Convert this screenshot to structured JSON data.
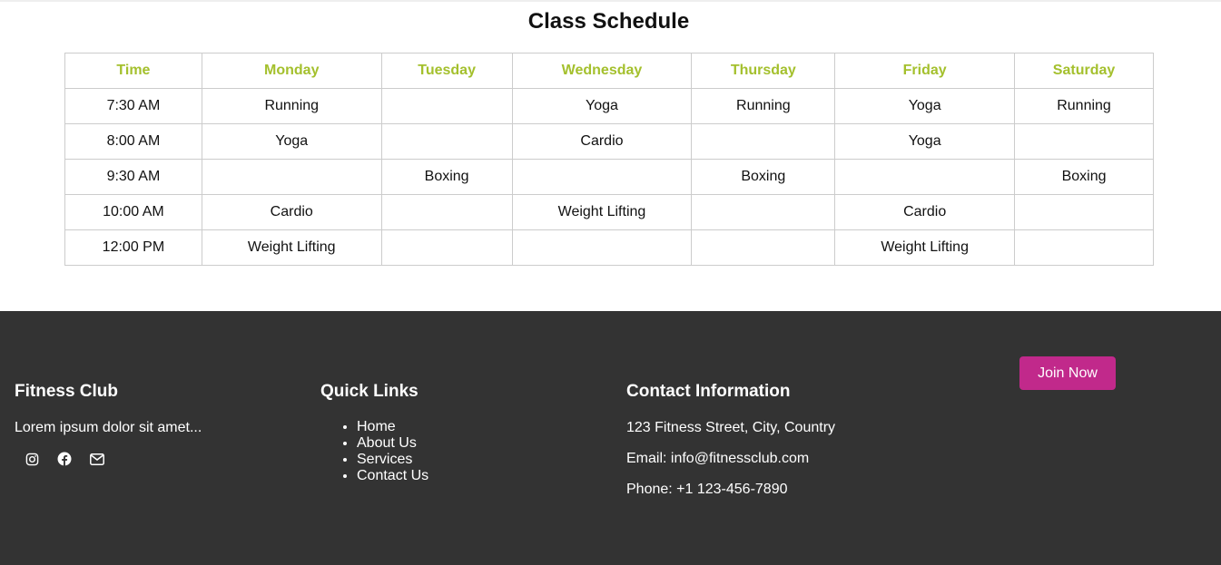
{
  "schedule": {
    "title": "Class Schedule",
    "headers": [
      "Time",
      "Monday",
      "Tuesday",
      "Wednesday",
      "Thursday",
      "Friday",
      "Saturday"
    ],
    "rows": [
      [
        "7:30 AM",
        "Running",
        "",
        "Yoga",
        "Running",
        "Yoga",
        "Running"
      ],
      [
        "8:00 AM",
        "Yoga",
        "",
        "Cardio",
        "",
        "Yoga",
        ""
      ],
      [
        "9:30 AM",
        "",
        "Boxing",
        "",
        "Boxing",
        "",
        "Boxing"
      ],
      [
        "10:00 AM",
        "Cardio",
        "",
        "Weight Lifting",
        "",
        "Cardio",
        ""
      ],
      [
        "12:00 PM",
        "Weight Lifting",
        "",
        "",
        "",
        "Weight Lifting",
        ""
      ]
    ],
    "header_color": "#a4c02d"
  },
  "footer": {
    "brand": {
      "title": "Fitness Club",
      "text": "Lorem ipsum dolor sit amet...",
      "social": [
        "instagram-icon",
        "facebook-icon",
        "envelope-icon"
      ]
    },
    "quick_links": {
      "title": "Quick Links",
      "items": [
        "Home",
        "About Us",
        "Services",
        "Contact Us"
      ]
    },
    "contact": {
      "title": "Contact Information",
      "address": "123 Fitness Street, City, Country",
      "email": "Email: info@fitnessclub.com",
      "phone": "Phone: +1 123-456-7890"
    },
    "join_label": "Join Now",
    "background": "#333333",
    "accent": "#c1298b"
  }
}
